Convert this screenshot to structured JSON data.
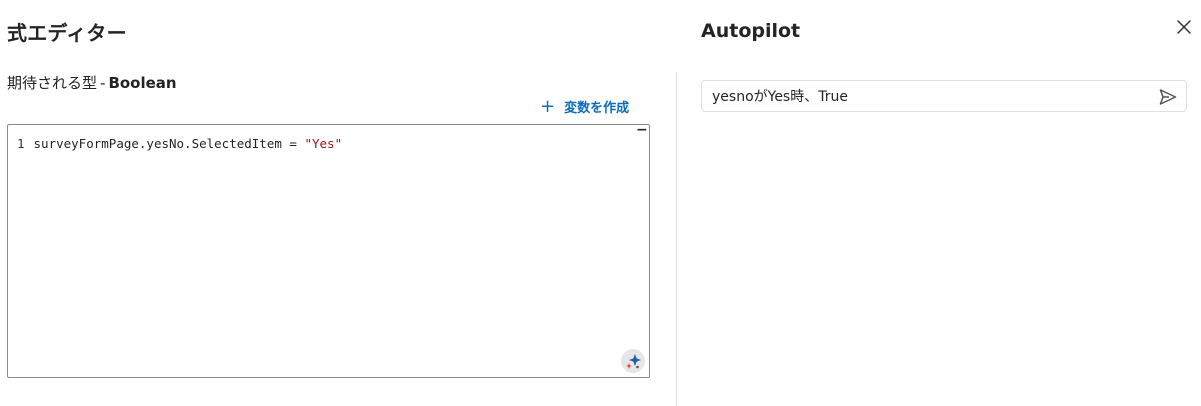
{
  "left_panel": {
    "title": "式エディター",
    "expected_type_label": "期待される型",
    "expected_type_sep": "-",
    "expected_type_value": "Boolean",
    "create_variable_label": "変数を作成"
  },
  "editor": {
    "line_number": "1",
    "code_prefix": "surveyFormPage.yesNo.SelectedItem = ",
    "code_string": "\"Yes\"",
    "collapse_symbol": "−"
  },
  "right_panel": {
    "title": "Autopilot",
    "prompt_value": "yesnoがYes時、True"
  },
  "colors": {
    "accent": "#0f6cbd",
    "string_literal": "#a31515",
    "border": "#8a8a8a",
    "divider": "#dcdcdc"
  },
  "icons": {
    "create": "plus-icon",
    "copilot": "sparkle-icon",
    "close": "close-icon",
    "send": "send-icon"
  }
}
